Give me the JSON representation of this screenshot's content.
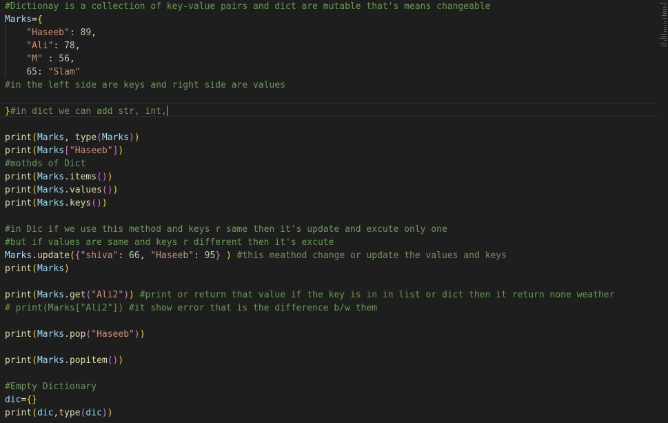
{
  "code_lines": [
    "#Dictionay is a collection of key-value pairs and dict are mutable that's means changeable",
    "Marks={",
    "    \"Haseeb\": 89,",
    "    \"Ali\": 78,",
    "    \"M\" : 56,",
    "    65: \"Slam\"",
    "#in the left side are keys and right side are values",
    "",
    "}#in dict we can add str, int,",
    "",
    "print(Marks, type(Marks))",
    "print(Marks[\"Haseeb\"])",
    "#mothds of Dict",
    "print(Marks.items())",
    "print(Marks.values())",
    "print(Marks.keys())",
    "",
    "#in Dic if we use this method and keys r same then it's update and excute only one",
    "#but if values are same and keys r different then it's excute",
    "Marks.update({\"shiva\": 66, \"Haseeb\": 95} ) #this meathod change or update the values and keys",
    "print(Marks)",
    "",
    "print(Marks.get(\"Ali2\")) #print or return that value if the key is in in list or dict then it return none weather",
    "# print(Marks[\"Ali2\"]) #it show error that is the difference b/w them",
    "",
    "print(Marks.pop(\"Haseeb\"))",
    "",
    "print(Marks.popitem())",
    "",
    "#Empty Dictionary",
    "dic={}",
    "print(dic,type(dic))"
  ],
  "colors": {
    "background": "#1e1e1e",
    "comment": "#6a9955",
    "variable": "#9cdcfe",
    "string": "#ce9178",
    "number": "#b5cea8",
    "function": "#dcdcaa",
    "bracket_level_1": "#ffd700",
    "bracket_level_2": "#da70d6",
    "bracket_level_3": "#179fff"
  },
  "cursor": {
    "line_number": 9
  }
}
